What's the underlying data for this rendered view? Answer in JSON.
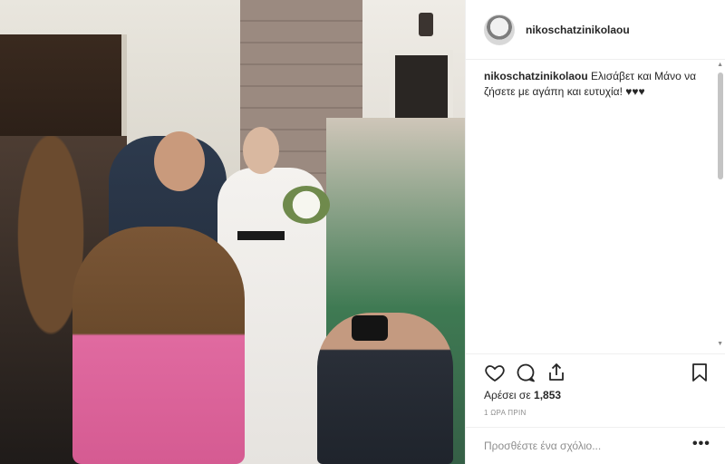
{
  "post": {
    "username": "nikoschatzinikolaou",
    "caption_text": "Ελισάβετ και Μάνο να ζήσετε με αγάπη και ευτυχία! ♥♥♥",
    "likes_prefix": "Αρέσει σε",
    "likes_count": "1,853",
    "timestamp": "1 ΩΡΑ ΠΡΙΝ",
    "comment_placeholder": "Προσθέστε ένα σχόλιο...",
    "more_label": "•••"
  },
  "scrollbar": {
    "up": "▲",
    "down": "▼"
  },
  "icons": [
    "heart-icon",
    "comment-icon",
    "share-icon",
    "bookmark-icon"
  ]
}
